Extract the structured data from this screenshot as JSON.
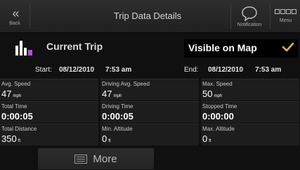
{
  "header": {
    "back_label": "Back",
    "title": "Trip Data Details",
    "notification_label": "Notification",
    "menu_label": "Menu"
  },
  "trip": {
    "title": "Current Trip",
    "visible_on_map_label": "Visible on Map",
    "visible_on_map_checked": true,
    "start_label": "Start:",
    "start_date": "08/12/2010",
    "start_time": "7:53 am",
    "end_label": "End:",
    "end_date": "08/12/2010",
    "end_time": "7:53 am"
  },
  "stats": [
    {
      "label": "Avg. Speed",
      "value": "47",
      "unit": "mph",
      "bold": false
    },
    {
      "label": "Driving Avg. Speed",
      "value": "47",
      "unit": "mph",
      "bold": false
    },
    {
      "label": "Max. Speed",
      "value": "50",
      "unit": "mph",
      "bold": false
    },
    {
      "label": "Total Time",
      "value": "0:00:05",
      "unit": "",
      "bold": true
    },
    {
      "label": "Driving Time",
      "value": "0:00:05",
      "unit": "",
      "bold": true
    },
    {
      "label": "Stopped Time",
      "value": "0:00:00",
      "unit": "",
      "bold": true
    },
    {
      "label": "Total Distance",
      "value": "350",
      "unit": "ft",
      "bold": false
    },
    {
      "label": "Min. Altitude",
      "value": "0",
      "unit": "ft",
      "bold": false
    },
    {
      "label": "Max. Altitude",
      "value": "0",
      "unit": "ft",
      "bold": false
    }
  ],
  "footer": {
    "more_label": "More"
  },
  "colors": {
    "accent_check": "#f0b429",
    "trip_icon_purple": "#b04fd0"
  },
  "icons": {
    "back": "double-chevron-left-icon",
    "notification": "speech-bubble-icon",
    "menu": "four-squares-icon",
    "trip": "bar-chart-trip-icon",
    "check": "check-icon",
    "more": "list-icon"
  }
}
